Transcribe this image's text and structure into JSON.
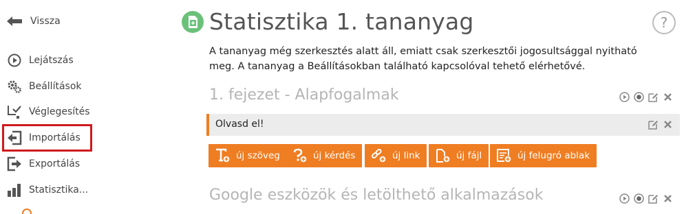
{
  "sidebar": {
    "back_label": "Vissza",
    "items": [
      {
        "label": "Lejátszás",
        "icon": "play-circle-icon"
      },
      {
        "label": "Beállítások",
        "icon": "gears-icon"
      },
      {
        "label": "Véglegesítés",
        "icon": "finalize-check-icon"
      },
      {
        "label": "Importálás",
        "icon": "import-icon"
      },
      {
        "label": "Exportálás",
        "icon": "export-icon"
      },
      {
        "label": "Statisztika...",
        "icon": "bar-chart-icon"
      }
    ]
  },
  "page": {
    "title": "Statisztika 1. tananyag",
    "help_label": "?",
    "notice": "A tananyag még szerkesztés alatt áll, emiatt csak szerkesztői jogosultsággal nyitható meg. A tananyag a Beállításokban található kapcsolóval tehető elérhetővé."
  },
  "chapters": [
    {
      "title": "1. fejezet - Alapfogalmak"
    },
    {
      "title": "Google eszközök és letölthető alkalmazások"
    }
  ],
  "task": {
    "label": "Olvasd el!"
  },
  "add_buttons": [
    {
      "label": "új szöveg",
      "icon": "new-text-icon"
    },
    {
      "label": "új kérdés",
      "icon": "new-question-icon"
    },
    {
      "label": "új link",
      "icon": "new-link-icon"
    },
    {
      "label": "új fájl",
      "icon": "new-file-icon"
    },
    {
      "label": "új felugró ablak",
      "icon": "new-popup-icon"
    }
  ],
  "colors": {
    "accent": "#ef7d22",
    "highlight": "#d0191c",
    "title_icon": "#6cc17a"
  }
}
